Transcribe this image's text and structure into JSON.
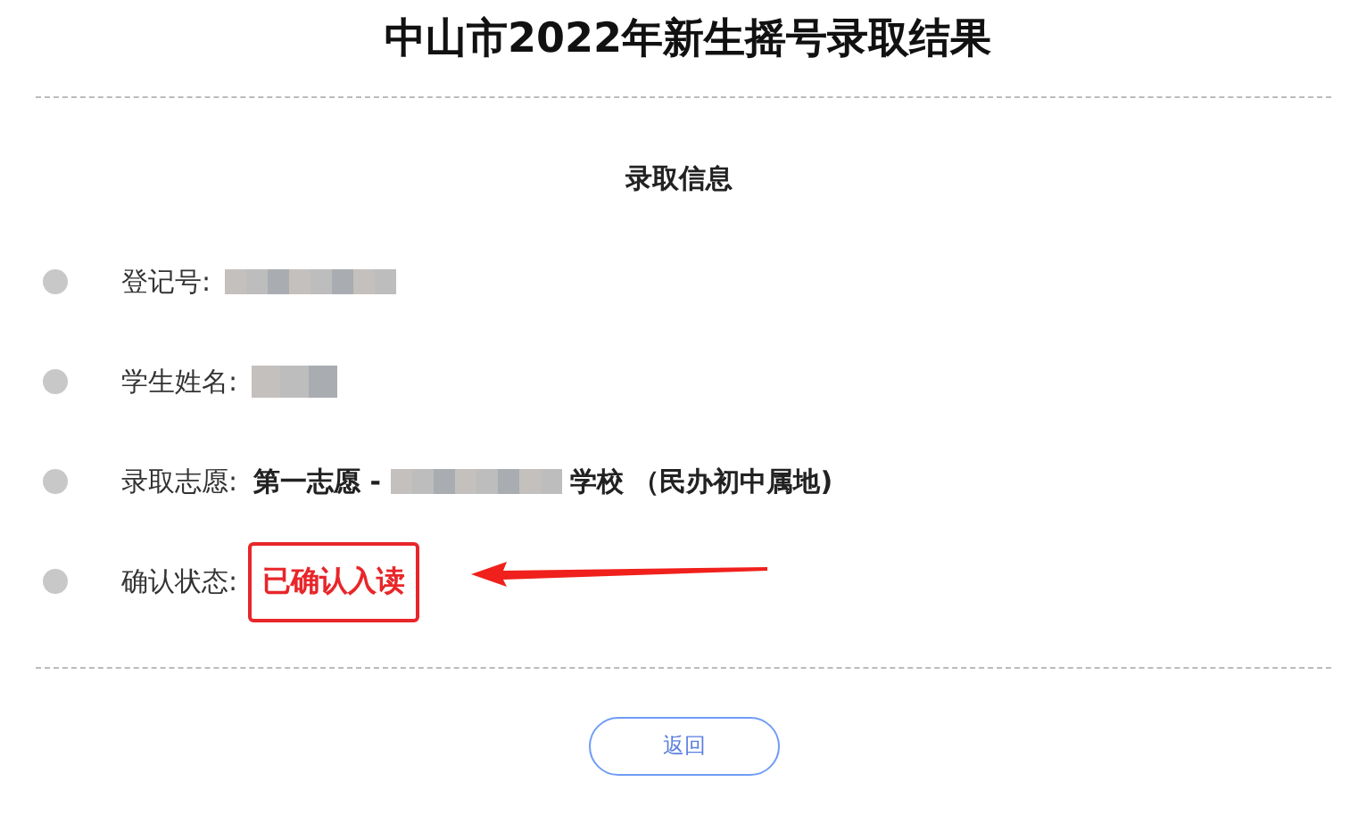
{
  "title": "中山市2022年新生摇号录取结果",
  "section_title": "录取信息",
  "rows": [
    {
      "label": "登记号:",
      "value_parts": [
        {
          "kind": "redacted"
        }
      ]
    },
    {
      "label": "学生姓名:",
      "value_parts": [
        {
          "kind": "redacted"
        }
      ]
    },
    {
      "label": "录取志愿:",
      "value_parts": [
        {
          "kind": "text",
          "text": "第一志愿 -"
        },
        {
          "kind": "redacted"
        },
        {
          "kind": "text",
          "text": "学校 （民办初中属地)"
        }
      ]
    },
    {
      "label": "确认状态:",
      "value_parts": [
        {
          "kind": "status",
          "text": "已确认入读",
          "highlighted": true
        }
      ]
    }
  ],
  "buttons": [
    {
      "label": "返回"
    }
  ]
}
